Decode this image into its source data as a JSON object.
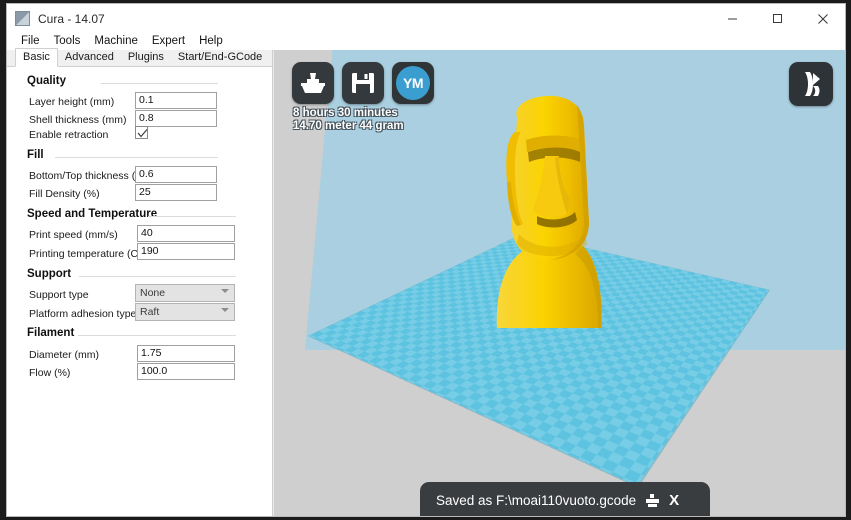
{
  "window": {
    "title": "Cura - 14.07",
    "icon": "cura-app-icon",
    "controls": {
      "minimize": "minimize-icon",
      "maximize": "maximize-icon",
      "close": "close-icon"
    }
  },
  "menubar": {
    "items": [
      "File",
      "Tools",
      "Machine",
      "Expert",
      "Help"
    ]
  },
  "tabs": {
    "items": [
      "Basic",
      "Advanced",
      "Plugins",
      "Start/End-GCode"
    ],
    "active": "Basic"
  },
  "settings": {
    "groups": [
      {
        "title": "Quality",
        "fields": [
          {
            "label": "Layer height (mm)",
            "type": "text",
            "value": "0.1"
          },
          {
            "label": "Shell thickness (mm)",
            "type": "text",
            "value": "0.8"
          },
          {
            "label": "Enable retraction",
            "type": "checkbox",
            "value": "checked"
          }
        ]
      },
      {
        "title": "Fill",
        "fields": [
          {
            "label": "Bottom/Top thickness (mm)",
            "type": "text",
            "value": "0.6"
          },
          {
            "label": "Fill Density (%)",
            "type": "text",
            "value": "25"
          }
        ]
      },
      {
        "title": "Speed and Temperature",
        "fields": [
          {
            "label": "Print speed (mm/s)",
            "type": "text",
            "value": "40"
          },
          {
            "label": "Printing temperature (C)",
            "type": "text",
            "value": "190"
          }
        ]
      },
      {
        "title": "Support",
        "fields": [
          {
            "label": "Support type",
            "type": "select",
            "value": "None"
          },
          {
            "label": "Platform adhesion type",
            "type": "select",
            "value": "Raft"
          }
        ]
      },
      {
        "title": "Filament",
        "fields": [
          {
            "label": "Diameter (mm)",
            "type": "text",
            "value": "1.75"
          },
          {
            "label": "Flow (%)",
            "type": "text",
            "value": "100.0"
          }
        ]
      }
    ]
  },
  "viewport": {
    "toolbar": [
      {
        "name": "print-button",
        "icon": "3d-printer-icon"
      },
      {
        "name": "save-toolpath-button",
        "icon": "floppy-disk-icon"
      },
      {
        "name": "youmagine-button",
        "icon": "youmagine-icon",
        "label": "YM"
      }
    ],
    "stats": {
      "time": "8 hours 30 minutes",
      "material": "14.70 meter 44 gram"
    },
    "view_mode_button": "layers-view-icon",
    "model": "moai-statue-model",
    "model_color": "#f2c300",
    "bed_color": "#5dc3e0",
    "backdrop_color": "#a9cfe0",
    "background_color": "#cfcfcf"
  },
  "toast": {
    "message": "Saved as F:\\moai110vuoto.gcode",
    "print_icon": "print-icon",
    "close_label": "X"
  }
}
